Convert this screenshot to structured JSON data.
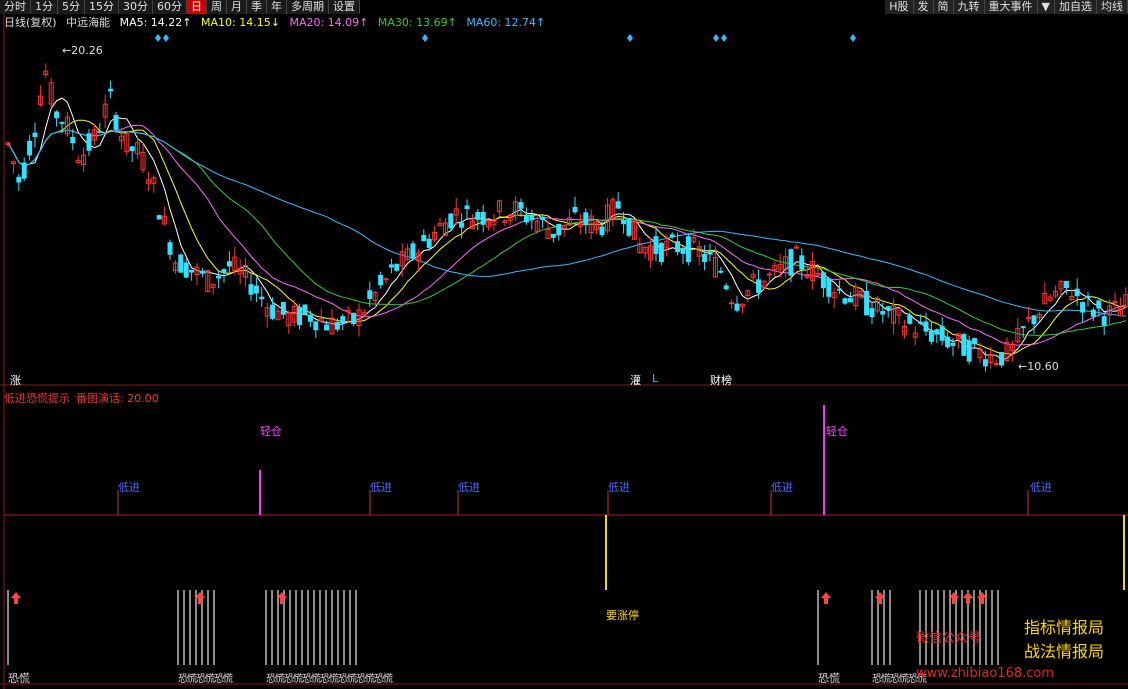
{
  "toolbar": {
    "periods": [
      "分时",
      "1分",
      "5分",
      "15分",
      "30分",
      "60分",
      "日",
      "周",
      "月",
      "季",
      "年",
      "多周期",
      "设置"
    ],
    "active_period": "日",
    "right_buttons": [
      "H股",
      "发",
      "简",
      "九转",
      "重大事件",
      "▼",
      "加自选",
      "均线"
    ]
  },
  "main": {
    "period_label": "日线(复权)",
    "stock_name": "中远海能",
    "ma": [
      {
        "label": "MA5: 14.22↑",
        "color": "#ffffff"
      },
      {
        "label": "MA10: 14.15↓",
        "color": "#ffff00"
      },
      {
        "label": "MA20: 14.09↑",
        "color": "#ff66ff"
      },
      {
        "label": "MA30: 13.69↑",
        "color": "#33cc33"
      },
      {
        "label": "MA60: 12.74↑",
        "color": "#33bbff"
      }
    ],
    "high_label": "20.26",
    "low_label": "10.60",
    "markers": [
      "涨",
      "灌",
      "L",
      "财榜"
    ]
  },
  "indicator": {
    "title": "低进恐慌提示",
    "subtitle": "番图演话: 20.00",
    "light_label": "轻仓",
    "low_entry_label": "低进",
    "limit_label": "要涨停",
    "panic_label": "恐慌",
    "panic_multi": "恐慌恐慌恐慌",
    "panic_long": "恐慌恐慌恐慌恐慌恐慌恐慌恐慌"
  },
  "watermark": {
    "wechat": "微信公众号",
    "brand1": "指标情报局",
    "brand2": "战法情报局",
    "site": "www.zhibiao168.com"
  },
  "colors": {
    "up": "#ff3333",
    "down": "#33e0ff",
    "ma5": "#ffffff",
    "ma10": "#ffff00",
    "ma20": "#ff66ff",
    "ma30": "#33cc33",
    "ma60": "#33bbff"
  }
}
